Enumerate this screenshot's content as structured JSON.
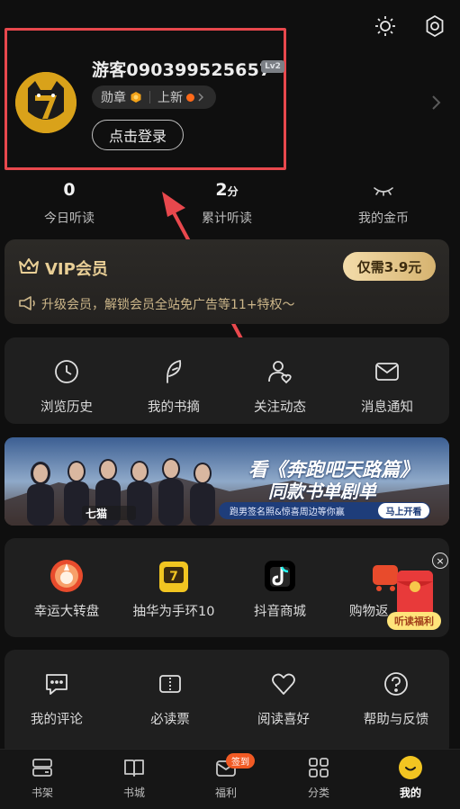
{
  "profile": {
    "username": "游客090399525657",
    "level": "Lv2",
    "medal_label": "勋章",
    "new_label": "上新",
    "login_label": "点击登录"
  },
  "stats": [
    {
      "value": "0",
      "unit": "",
      "label": "今日听读"
    },
    {
      "value": "2",
      "unit": "分",
      "label": "累计听读"
    },
    {
      "value": "",
      "unit": "",
      "label": "我的金币"
    }
  ],
  "vip": {
    "title": "VIP会员",
    "price_label": "仅需3.9元",
    "description": "升级会员，解锁会员全站免广告等11+特权～"
  },
  "quick_actions": [
    {
      "label": "浏览历史",
      "icon": "clock-icon"
    },
    {
      "label": "我的书摘",
      "icon": "feather-icon"
    },
    {
      "label": "关注动态",
      "icon": "user-heart-icon"
    },
    {
      "label": "消息通知",
      "icon": "mail-icon"
    }
  ],
  "banner": {
    "title": "看《奔跑吧天路篇》",
    "subtitle": "同款书单剧单",
    "strip_text": "跑男签名照&惊喜周边等你赢",
    "cta": "马上开看",
    "brand": "七猫"
  },
  "promos": [
    {
      "label": "幸运大转盘",
      "icon": "wheel-icon"
    },
    {
      "label": "抽华为手环10",
      "icon": "slot-machine-icon"
    },
    {
      "label": "抖音商城",
      "icon": "douyin-icon"
    },
    {
      "label": "购物返",
      "icon": "cart-icon"
    }
  ],
  "reward_float": {
    "label": "听读福利",
    "close": "×"
  },
  "more_actions": [
    {
      "label": "我的评论",
      "icon": "comment-icon"
    },
    {
      "label": "必读票",
      "icon": "ticket-icon"
    },
    {
      "label": "阅读喜好",
      "icon": "heart-icon"
    },
    {
      "label": "帮助与反馈",
      "icon": "help-icon"
    }
  ],
  "bottom_nav": [
    {
      "label": "书架",
      "icon": "bookshelf-icon"
    },
    {
      "label": "书城",
      "icon": "book-icon"
    },
    {
      "label": "福利",
      "icon": "gift-mail-icon",
      "badge": "签到"
    },
    {
      "label": "分类",
      "icon": "grid-icon"
    },
    {
      "label": "我的",
      "icon": "smile-icon",
      "active": true
    }
  ],
  "colors": {
    "accent_gold": "#e9cf96",
    "active_yellow": "#f2c521",
    "highlight_red": "#e8484d"
  }
}
